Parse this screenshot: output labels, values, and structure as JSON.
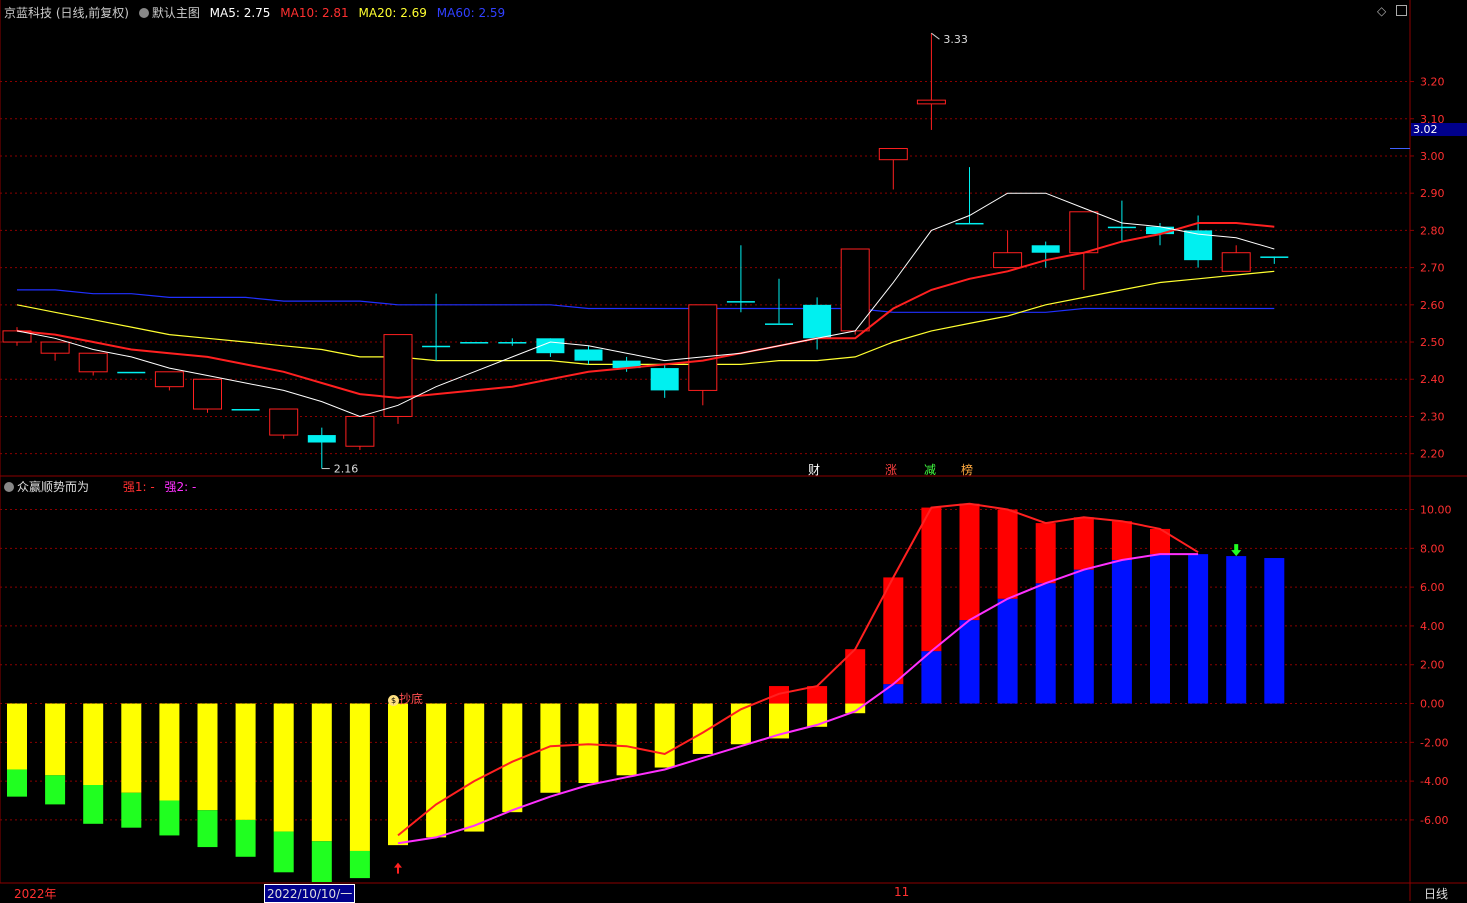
{
  "header": {
    "title": "京蓝科技 (日线,前复权)",
    "template": "默认主图",
    "ma": [
      {
        "label": "MA5: 2.75",
        "color": "#ffffff"
      },
      {
        "label": "MA10: 2.81",
        "color": "#ff3030"
      },
      {
        "label": "MA20: 2.69",
        "color": "#ffff30"
      },
      {
        "label": "MA60: 2.59",
        "color": "#2030ff"
      }
    ]
  },
  "indicator_header": {
    "name": "众赢顺势而为",
    "s1": "强1: -",
    "s2": "强2: -"
  },
  "footer": {
    "year": "2022年",
    "date": "2022/10/10/一",
    "month": "11",
    "period": "日线"
  },
  "markers": {
    "cai": "财",
    "zhang": "涨",
    "jian": "减",
    "bang": "榜",
    "chaodi": "抄底"
  },
  "colors": {
    "up": "#ff2020",
    "down": "#00f0f0",
    "ma5": "#ffffff",
    "ma10": "#ff2020",
    "ma20": "#ffff30",
    "ma60": "#2030ff",
    "grid": "#8b0000",
    "bar_yellow": "#ffff00",
    "bar_green": "#20ff20",
    "bar_red": "#ff0000",
    "bar_blue": "#0010ff",
    "line_red": "#ff2020",
    "line_magenta": "#ff30ff"
  },
  "chart_data": [
    {
      "type": "candlestick",
      "ylim": [
        2.14,
        3.36
      ],
      "yticks": [
        "3.20",
        "3.10",
        "3.00",
        "2.90",
        "2.80",
        "2.70",
        "2.60",
        "2.50",
        "2.40",
        "2.30",
        "2.20"
      ],
      "ytick_values": [
        3.2,
        3.1,
        3.0,
        2.9,
        2.8,
        2.7,
        2.6,
        2.5,
        2.4,
        2.3,
        2.2
      ],
      "current_price": "3.02",
      "high_label": "3.33",
      "low_label": "2.16",
      "candles": [
        [
          2.5,
          2.53,
          2.49,
          2.54
        ],
        [
          2.47,
          2.5,
          2.45,
          2.5
        ],
        [
          2.42,
          2.47,
          2.41,
          2.47
        ],
        [
          2.42,
          2.42,
          2.42,
          2.42
        ],
        [
          2.38,
          2.42,
          2.37,
          2.42
        ],
        [
          2.32,
          2.4,
          2.31,
          2.4
        ],
        [
          2.32,
          2.32,
          2.32,
          2.32
        ],
        [
          2.25,
          2.32,
          2.24,
          2.32
        ],
        [
          2.25,
          2.23,
          2.16,
          2.27
        ],
        [
          2.22,
          2.3,
          2.21,
          2.3
        ],
        [
          2.3,
          2.52,
          2.28,
          2.52
        ],
        [
          2.49,
          2.49,
          2.45,
          2.63
        ],
        [
          2.5,
          2.5,
          2.5,
          2.5
        ],
        [
          2.5,
          2.5,
          2.49,
          2.51
        ],
        [
          2.51,
          2.47,
          2.46,
          2.51
        ],
        [
          2.48,
          2.45,
          2.44,
          2.49
        ],
        [
          2.45,
          2.43,
          2.42,
          2.46
        ],
        [
          2.43,
          2.37,
          2.35,
          2.44
        ],
        [
          2.37,
          2.6,
          2.33,
          2.6
        ],
        [
          2.61,
          2.61,
          2.58,
          2.76
        ],
        [
          2.55,
          2.55,
          2.55,
          2.67
        ],
        [
          2.6,
          2.51,
          2.48,
          2.62
        ],
        [
          2.53,
          2.75,
          2.52,
          2.75
        ],
        [
          2.99,
          3.02,
          2.91,
          3.02
        ],
        [
          3.14,
          3.15,
          3.07,
          3.33
        ],
        [
          2.82,
          2.82,
          2.82,
          2.97
        ],
        [
          2.7,
          2.74,
          2.7,
          2.8
        ],
        [
          2.76,
          2.74,
          2.7,
          2.77
        ],
        [
          2.74,
          2.85,
          2.64,
          2.85
        ],
        [
          2.81,
          2.81,
          2.77,
          2.88
        ],
        [
          2.81,
          2.79,
          2.76,
          2.82
        ],
        [
          2.8,
          2.72,
          2.7,
          2.84
        ],
        [
          2.69,
          2.74,
          2.69,
          2.76
        ],
        [
          2.73,
          2.73,
          2.71,
          2.73
        ]
      ],
      "ma5": [
        2.53,
        2.51,
        2.48,
        2.46,
        2.43,
        2.41,
        2.39,
        2.37,
        2.34,
        2.3,
        2.33,
        2.38,
        2.42,
        2.46,
        2.5,
        2.49,
        2.47,
        2.45,
        2.46,
        2.47,
        2.49,
        2.51,
        2.53,
        2.66,
        2.8,
        2.84,
        2.9,
        2.9,
        2.86,
        2.82,
        2.81,
        2.79,
        2.78,
        2.75
      ],
      "ma10": [
        2.53,
        2.52,
        2.5,
        2.48,
        2.47,
        2.46,
        2.44,
        2.42,
        2.39,
        2.36,
        2.35,
        2.36,
        2.37,
        2.38,
        2.4,
        2.42,
        2.43,
        2.44,
        2.45,
        2.47,
        2.49,
        2.51,
        2.51,
        2.59,
        2.64,
        2.67,
        2.69,
        2.72,
        2.74,
        2.77,
        2.79,
        2.82,
        2.82,
        2.81
      ],
      "ma20": [
        2.6,
        2.58,
        2.56,
        2.54,
        2.52,
        2.51,
        2.5,
        2.49,
        2.48,
        2.46,
        2.46,
        2.45,
        2.45,
        2.45,
        2.45,
        2.44,
        2.44,
        2.44,
        2.44,
        2.44,
        2.45,
        2.45,
        2.46,
        2.5,
        2.53,
        2.55,
        2.57,
        2.6,
        2.62,
        2.64,
        2.66,
        2.67,
        2.68,
        2.69
      ],
      "ma60": [
        2.64,
        2.64,
        2.63,
        2.63,
        2.62,
        2.62,
        2.62,
        2.61,
        2.61,
        2.61,
        2.6,
        2.6,
        2.6,
        2.6,
        2.6,
        2.59,
        2.59,
        2.59,
        2.59,
        2.59,
        2.59,
        2.59,
        2.59,
        2.58,
        2.58,
        2.58,
        2.58,
        2.58,
        2.59,
        2.59,
        2.59,
        2.59,
        2.59,
        2.59
      ]
    },
    {
      "type": "bar",
      "ylim": [
        -9.2,
        10.8
      ],
      "yticks": [
        "10.00",
        "8.00",
        "6.00",
        "4.00",
        "2.00",
        "0.00",
        "-2.00",
        "-4.00",
        "-6.00"
      ],
      "ytick_values": [
        10,
        8,
        6,
        4,
        2,
        0,
        -2,
        -4,
        -6
      ],
      "yellow": [
        -3.4,
        -3.7,
        -4.2,
        -4.6,
        -5.0,
        -5.5,
        -6.0,
        -6.6,
        -7.1,
        -7.6,
        -7.3,
        -6.9,
        -6.6,
        -5.6,
        -4.6,
        -4.1,
        -3.7,
        -3.3,
        -2.6,
        -2.1,
        -1.8,
        -1.2,
        -0.5
      ],
      "green": [
        -4.8,
        -5.2,
        -6.2,
        -6.4,
        -6.8,
        -7.4,
        -7.9,
        -8.7,
        -9.2,
        -9.0,
        null,
        null,
        null,
        null,
        null,
        null,
        null,
        null,
        null,
        null,
        null,
        null,
        null
      ],
      "red_top": [
        null,
        null,
        null,
        null,
        null,
        null,
        null,
        null,
        null,
        null,
        null,
        null,
        null,
        null,
        null,
        null,
        null,
        null,
        null,
        null,
        0.9,
        0.9,
        2.8,
        6.5,
        10.1,
        10.3,
        10.0,
        9.3,
        9.6,
        9.4,
        9.0,
        7.8,
        null,
        null
      ],
      "red_bottom": [
        null,
        null,
        null,
        null,
        null,
        null,
        null,
        null,
        null,
        null,
        null,
        null,
        null,
        null,
        null,
        null,
        null,
        null,
        null,
        null,
        0.0,
        0.0,
        0.0,
        1.0,
        2.7,
        4.3,
        5.4,
        6.2,
        6.9,
        7.4,
        7.7,
        7.8,
        null,
        null
      ],
      "blue": [
        null,
        null,
        null,
        null,
        null,
        null,
        null,
        null,
        null,
        null,
        null,
        null,
        null,
        null,
        null,
        null,
        null,
        null,
        null,
        null,
        null,
        null,
        null,
        1.0,
        2.7,
        4.3,
        5.4,
        6.2,
        6.9,
        7.4,
        7.7,
        7.7,
        7.6,
        7.5
      ],
      "red_line": [
        null,
        null,
        null,
        null,
        null,
        null,
        null,
        null,
        null,
        null,
        -6.8,
        -5.2,
        -4.0,
        -3.0,
        -2.2,
        -2.1,
        -2.2,
        -2.6,
        -1.5,
        -0.3,
        0.5,
        0.9,
        2.8,
        6.5,
        10.1,
        10.3,
        10.0,
        9.3,
        9.6,
        9.4,
        9.0,
        7.8,
        null,
        null
      ],
      "magenta_line": [
        null,
        null,
        null,
        null,
        null,
        null,
        null,
        null,
        null,
        null,
        -7.2,
        -6.9,
        -6.3,
        -5.5,
        -4.8,
        -4.2,
        -3.8,
        -3.4,
        -2.8,
        -2.2,
        -1.6,
        -1.1,
        -0.4,
        1.0,
        2.7,
        4.3,
        5.4,
        6.2,
        6.9,
        7.4,
        7.7,
        7.7,
        null,
        null
      ]
    }
  ]
}
